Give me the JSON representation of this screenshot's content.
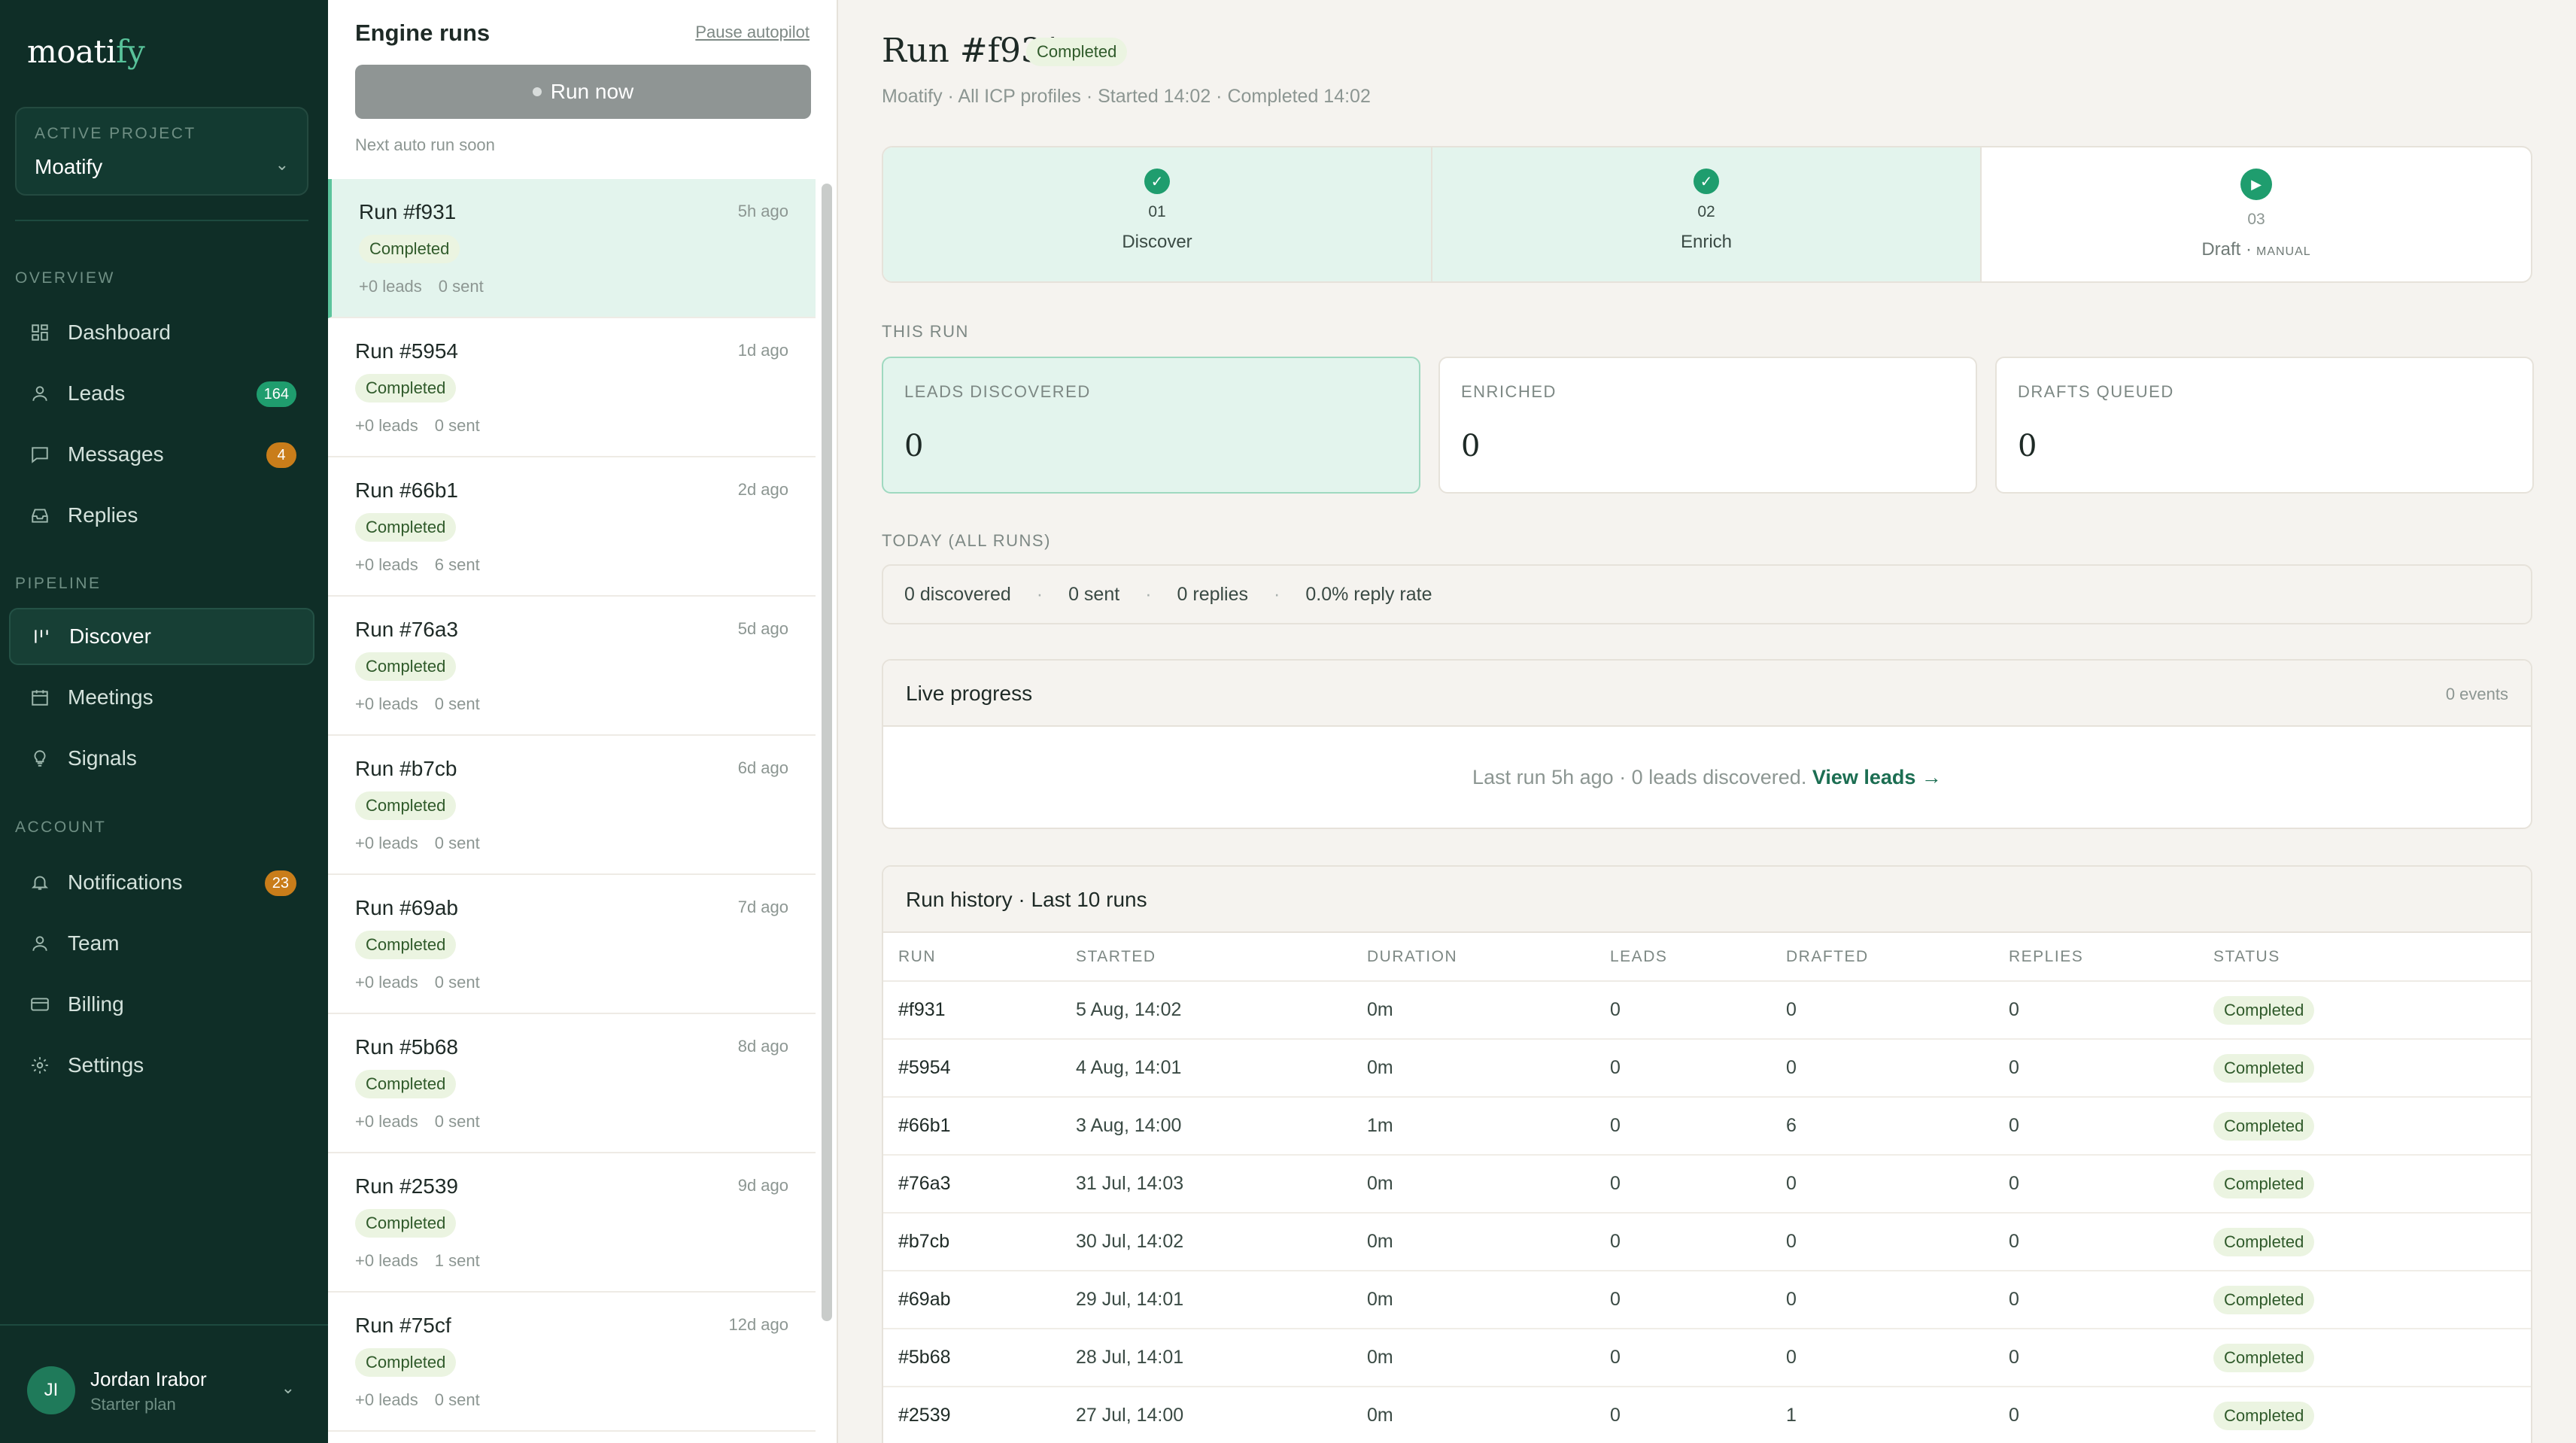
{
  "sidebar": {
    "logo_main": "moati",
    "logo_accent": "fy",
    "project_label": "ACTIVE PROJECT",
    "project_value": "Moatify",
    "sections": {
      "overview": "OVERVIEW",
      "pipeline": "PIPELINE",
      "account": "ACCOUNT"
    },
    "items": [
      {
        "label": "Dashboard",
        "icon": "grid-icon"
      },
      {
        "label": "Leads",
        "icon": "user-icon",
        "badge": "164"
      },
      {
        "label": "Messages",
        "icon": "message-icon",
        "badge": "4"
      },
      {
        "label": "Replies",
        "icon": "inbox-icon"
      },
      {
        "label": "Discover",
        "icon": "bars-icon"
      },
      {
        "label": "Meetings",
        "icon": "calendar-icon"
      },
      {
        "label": "Signals",
        "icon": "bulb-icon"
      },
      {
        "label": "Notifications",
        "icon": "bell-icon",
        "badge": "23"
      },
      {
        "label": "Team",
        "icon": "team-icon"
      },
      {
        "label": "Billing",
        "icon": "card-icon"
      },
      {
        "label": "Settings",
        "icon": "gear-icon"
      }
    ],
    "user": {
      "initials": "JI",
      "name": "Jordan Irabor",
      "plan": "Starter plan"
    }
  },
  "runs": {
    "title": "Engine runs",
    "pause_label": "Pause autopilot",
    "run_now_label": "Run now",
    "next_run": "Next auto run soon",
    "items": [
      {
        "id": "Run #f931",
        "ago": "5h ago",
        "status": "Completed",
        "leads": "+0 leads",
        "sent": "0 sent"
      },
      {
        "id": "Run #5954",
        "ago": "1d ago",
        "status": "Completed",
        "leads": "+0 leads",
        "sent": "0 sent"
      },
      {
        "id": "Run #66b1",
        "ago": "2d ago",
        "status": "Completed",
        "leads": "+0 leads",
        "sent": "6 sent"
      },
      {
        "id": "Run #76a3",
        "ago": "5d ago",
        "status": "Completed",
        "leads": "+0 leads",
        "sent": "0 sent"
      },
      {
        "id": "Run #b7cb",
        "ago": "6d ago",
        "status": "Completed",
        "leads": "+0 leads",
        "sent": "0 sent"
      },
      {
        "id": "Run #69ab",
        "ago": "7d ago",
        "status": "Completed",
        "leads": "+0 leads",
        "sent": "0 sent"
      },
      {
        "id": "Run #5b68",
        "ago": "8d ago",
        "status": "Completed",
        "leads": "+0 leads",
        "sent": "0 sent"
      },
      {
        "id": "Run #2539",
        "ago": "9d ago",
        "status": "Completed",
        "leads": "+0 leads",
        "sent": "1 sent"
      },
      {
        "id": "Run #75cf",
        "ago": "12d ago",
        "status": "Completed",
        "leads": "+0 leads",
        "sent": "0 sent"
      }
    ]
  },
  "main": {
    "title": "Run #f931",
    "status": "Completed",
    "subtitle": "Moatify · All ICP profiles · Started 14:02 · Completed 14:02",
    "steps": [
      {
        "num": "01",
        "name": "Discover"
      },
      {
        "num": "02",
        "name": "Enrich"
      },
      {
        "num": "03",
        "name": "Draft ·",
        "tag": "MANUAL"
      }
    ],
    "this_run_label": "THIS RUN",
    "stats": [
      {
        "label": "LEADS DISCOVERED",
        "value": "0"
      },
      {
        "label": "ENRICHED",
        "value": "0"
      },
      {
        "label": "DRAFTS QUEUED",
        "value": "0"
      }
    ],
    "today_label": "TODAY (ALL RUNS)",
    "today": {
      "discovered": "0 discovered",
      "sent": "0 sent",
      "replies": "0 replies",
      "rate": "0.0% reply rate",
      "sep": "·"
    },
    "live": {
      "title": "Live progress",
      "events": "0 events",
      "message": "Last run 5h ago · 0 leads discovered.",
      "link": "View leads →"
    },
    "history": {
      "title": "Run history · Last 10 runs",
      "columns": [
        "RUN",
        "STARTED",
        "DURATION",
        "LEADS",
        "DRAFTED",
        "REPLIES",
        "STATUS"
      ],
      "rows": [
        [
          "#f931",
          "5 Aug, 14:02",
          "0m",
          "0",
          "0",
          "0",
          "Completed"
        ],
        [
          "#5954",
          "4 Aug, 14:01",
          "0m",
          "0",
          "0",
          "0",
          "Completed"
        ],
        [
          "#66b1",
          "3 Aug, 14:00",
          "1m",
          "0",
          "6",
          "0",
          "Completed"
        ],
        [
          "#76a3",
          "31 Jul, 14:03",
          "0m",
          "0",
          "0",
          "0",
          "Completed"
        ],
        [
          "#b7cb",
          "30 Jul, 14:02",
          "0m",
          "0",
          "0",
          "0",
          "Completed"
        ],
        [
          "#69ab",
          "29 Jul, 14:01",
          "0m",
          "0",
          "0",
          "0",
          "Completed"
        ],
        [
          "#5b68",
          "28 Jul, 14:01",
          "0m",
          "0",
          "0",
          "0",
          "Completed"
        ],
        [
          "#2539",
          "27 Jul, 14:00",
          "0m",
          "0",
          "1",
          "0",
          "Completed"
        ]
      ]
    }
  },
  "colors": {
    "sidebar": "#0f2e27",
    "accent": "#1f9d6e",
    "badge_orange": "#c97d1a",
    "pill_bg": "#ebf4e1",
    "highlight": "#e3f4ed"
  }
}
